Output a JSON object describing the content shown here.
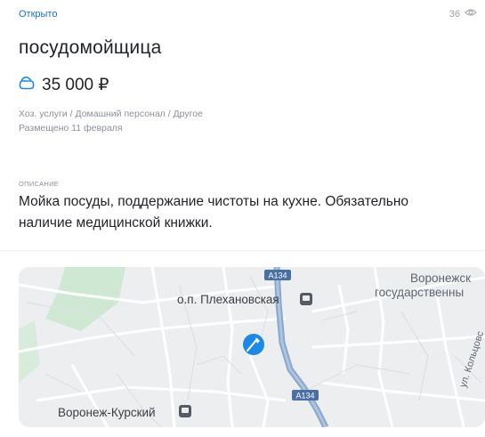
{
  "status": "Открыто",
  "views": "36",
  "title": "посудомойщица",
  "salary": "35 000 ₽",
  "category": "Хоз. услуги / Домашний персонал / Другое",
  "posted": "Размещено 11 февраля",
  "description_label": "описание",
  "description": "Мойка посуды, поддержание чистоты на кухне. Обязательно наличие медицинской книжки.",
  "map": {
    "road_badge": "А134",
    "station_top": "о.п. Плехановская",
    "university": [
      "Воронежск",
      "государственны"
    ],
    "station_bottom": "Воронеж-Курский",
    "street": "ул. Кольцовс"
  },
  "colors": {
    "accent": "#1a6ed8",
    "pin": "#1e88e5"
  }
}
